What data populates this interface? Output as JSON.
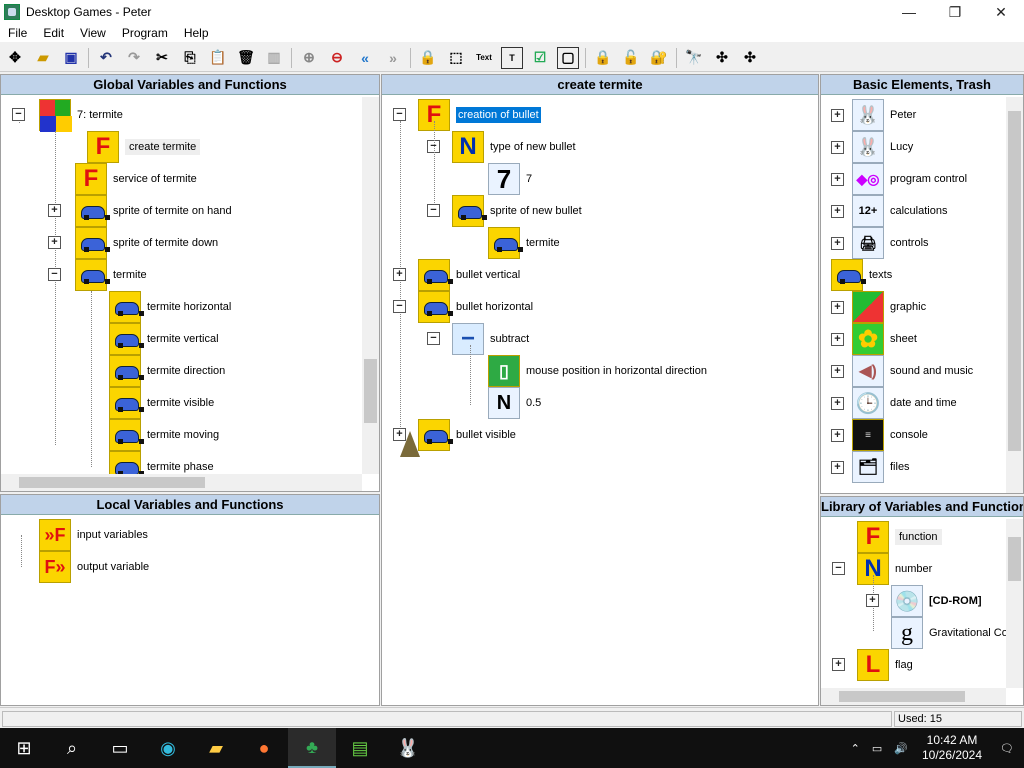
{
  "window": {
    "title": "Desktop Games - Peter",
    "minimize": "—",
    "maximize": "❐",
    "close": "✕"
  },
  "menu": [
    "File",
    "Edit",
    "View",
    "Program",
    "Help"
  ],
  "toolbar": {
    "text_button": "Text"
  },
  "global_panel": {
    "header": "Global Variables and Functions",
    "root": "7: termite",
    "items": [
      "create termite",
      "service of termite",
      "sprite of termite on hand",
      "sprite of termite down",
      "termite",
      "termite horizontal",
      "termite vertical",
      "termite direction",
      "termite visible",
      "termite moving",
      "termite phase"
    ]
  },
  "local_panel": {
    "header": "Local Variables and Functions",
    "items": [
      "input variables",
      "output variable"
    ]
  },
  "editor_panel": {
    "header": "create termite",
    "items": {
      "root": "creation of bullet",
      "type": "type of new bullet",
      "seven": "7",
      "sprite": "sprite of new bullet",
      "termite": "termite",
      "bvert": "bullet vertical",
      "bhoriz": "bullet horizontal",
      "subtract": "subtract",
      "mouse": "mouse position in horizontal direction",
      "half": "0.5",
      "bvis": "bullet visible"
    }
  },
  "basic_panel": {
    "header": "Basic Elements, Trash",
    "items": [
      "Peter",
      "Lucy",
      "program control",
      "calculations",
      "controls",
      "texts",
      "graphic",
      "sheet",
      "sound and music",
      "date and time",
      "console",
      "files"
    ]
  },
  "library_panel": {
    "header": "Library of Variables and Functions",
    "items": [
      "function",
      "number",
      "[CD-ROM]",
      "Gravitational Co",
      "flag"
    ]
  },
  "status": {
    "used": "Used: 15"
  },
  "taskbar": {
    "time": "10:42 AM",
    "date": "10/26/2024"
  },
  "icons": {
    "seven": "7",
    "N": "N",
    "F": "F",
    "L": "L",
    "g": "g",
    "minus": "−"
  }
}
